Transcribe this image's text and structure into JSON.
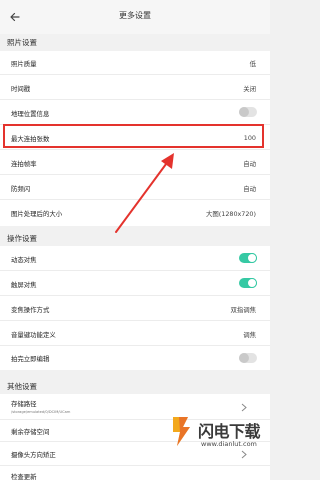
{
  "header": {
    "back_icon": "arrow-left-icon",
    "title": "更多设置"
  },
  "sections": {
    "photo": {
      "title": "照片设置",
      "items": [
        {
          "label": "照片质量",
          "value": "低"
        },
        {
          "label": "时间戳",
          "value": "关闭"
        },
        {
          "label": "地理位置信息",
          "toggle": "off"
        },
        {
          "label": "最大连拍张数",
          "value": "100",
          "highlighted": true
        },
        {
          "label": "连拍帧率",
          "value": "自动"
        },
        {
          "label": "防频闪",
          "value": "自动"
        },
        {
          "label": "图片处理后的大小",
          "value": "大图(1280x720)"
        }
      ]
    },
    "operation": {
      "title": "操作设置",
      "items": [
        {
          "label": "动态对焦",
          "toggle": "on"
        },
        {
          "label": "触屏对焦",
          "toggle": "on"
        },
        {
          "label": "变焦操作方式",
          "value": "双指调焦"
        },
        {
          "label": "音量键功能定义",
          "value": "调焦"
        },
        {
          "label": "拍完立即编辑",
          "toggle": "off"
        }
      ]
    },
    "other": {
      "title": "其他设置",
      "items": [
        {
          "label": "存储路径",
          "sub": "/storage/emulated/0/DCIM/UCam",
          "chevron": "chevron-right-icon"
        },
        {
          "label": "剩余存储空间"
        },
        {
          "label": "摄像头方向矫正",
          "chevron": "chevron-right-icon"
        },
        {
          "label": "检查更新"
        }
      ]
    }
  },
  "watermark": {
    "brand": "闪电下载",
    "url": "www.dianlut.com",
    "logo_icon": "lightning-logo-icon"
  },
  "colors": {
    "toggle_on": "#36c9a4",
    "highlight_red": "#e4332d"
  }
}
